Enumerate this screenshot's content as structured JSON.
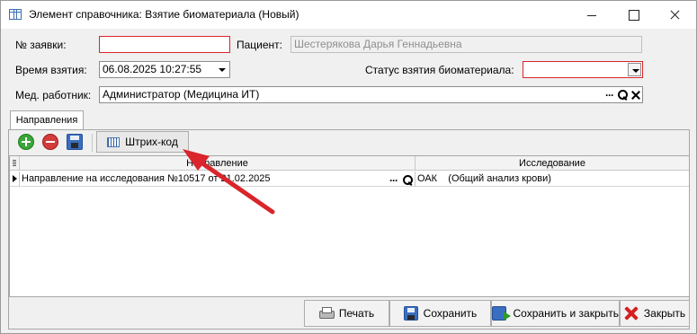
{
  "window": {
    "title": "Элемент справочника: Взятие биоматериала (Новый)"
  },
  "form": {
    "request_no": {
      "label": "№ заявки:",
      "value": ""
    },
    "patient": {
      "label": "Пациент:",
      "value": "Шестерякова Дарья Геннадьевна"
    },
    "taken_time": {
      "label": "Время взятия:",
      "value": "06.08.2025 10:27:55"
    },
    "status": {
      "label": "Статус взятия биоматериала:",
      "value": ""
    },
    "med_worker": {
      "label": "Мед. работник:",
      "value": "Администратор (Медицина ИТ)"
    }
  },
  "tabs": [
    {
      "label": "Направления"
    }
  ],
  "toolbar": {
    "barcode_label": "Штрих-код"
  },
  "grid": {
    "columns": [
      "Направление",
      "Исследование"
    ],
    "rows": [
      {
        "direction": "Направление на исследования №10517 от 21.02.2025",
        "research": "ОАК    (Общий анализ крови)"
      }
    ]
  },
  "buttons": {
    "print": "Печать",
    "save": "Сохранить",
    "save_close": "Сохранить и закрыть",
    "close": "Закрыть"
  },
  "colors": {
    "required_border": "#d9252b",
    "annotation_arrow": "#d9252b"
  }
}
